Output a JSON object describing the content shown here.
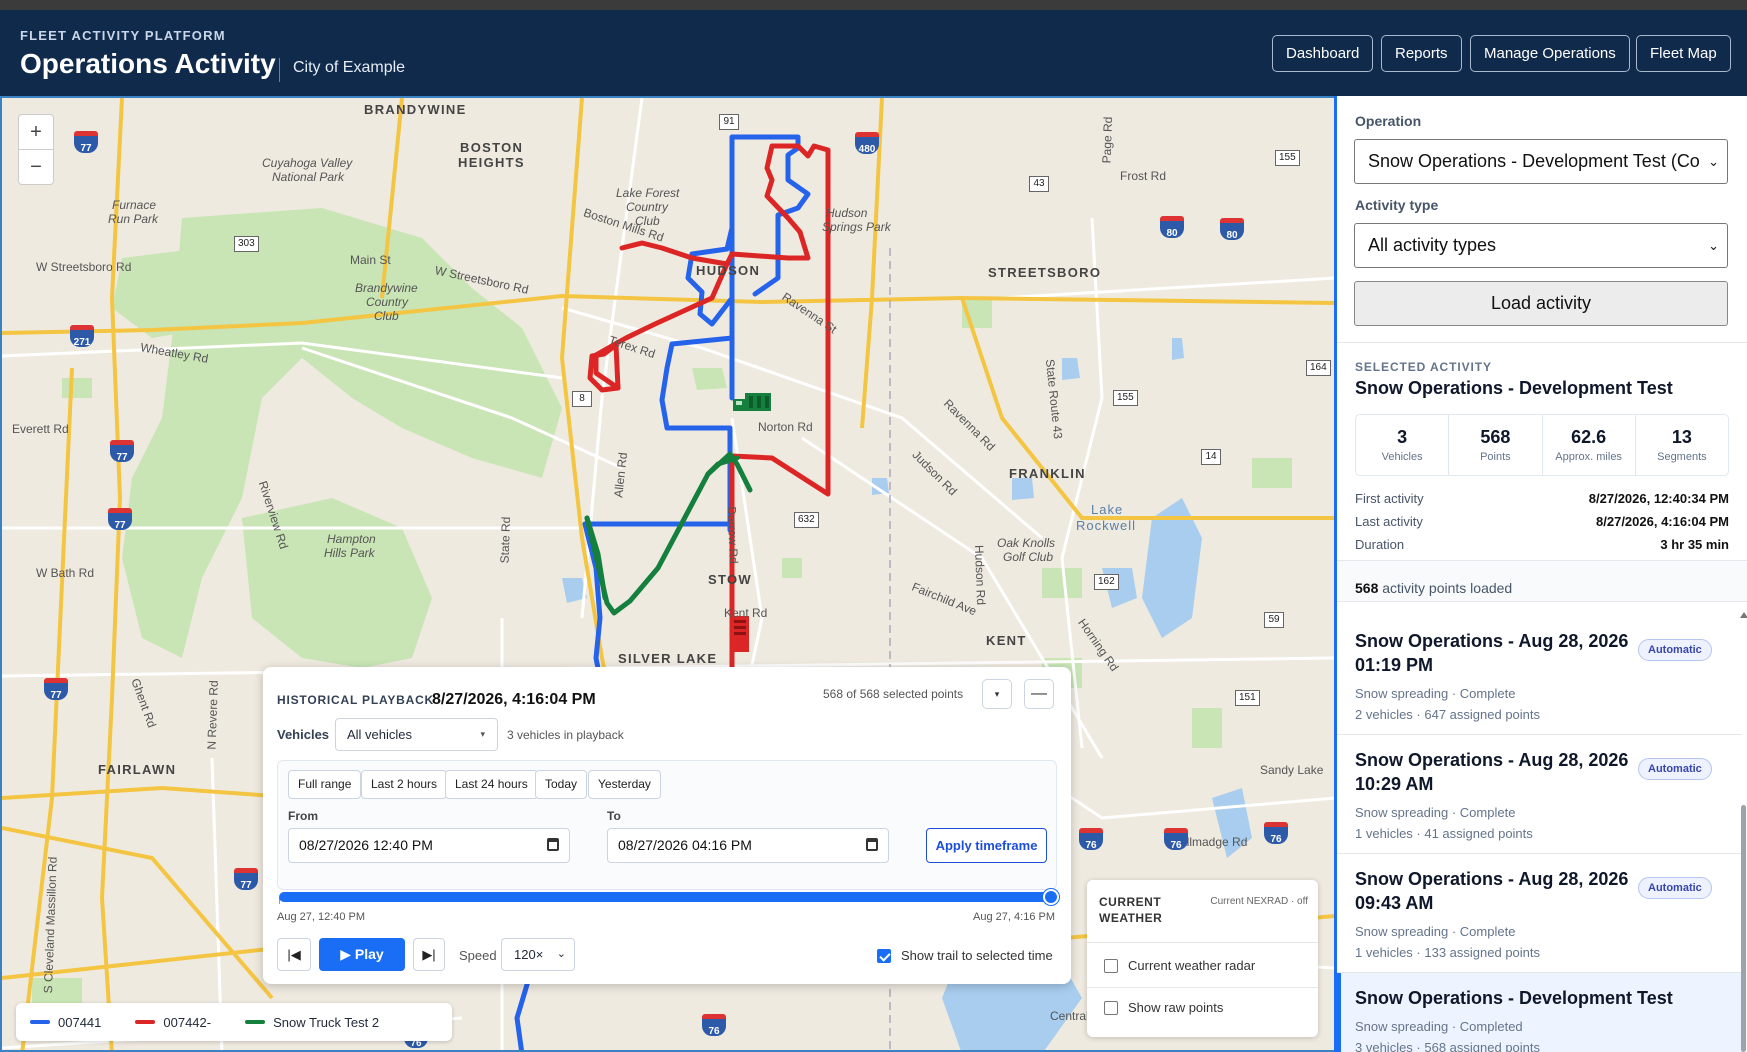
{
  "header": {
    "super_title": "FLEET ACTIVITY PLATFORM",
    "title": "Operations Activity",
    "org": "City of Example",
    "nav": [
      "Dashboard",
      "Reports",
      "Manage Operations",
      "Fleet Map"
    ]
  },
  "map": {
    "zoom_in": "+",
    "zoom_out": "−",
    "towns": [
      "BRANDYWINE",
      "BOSTON",
      "HEIGHTS",
      "HUDSON",
      "STREETSBORO",
      "FRANKLIN",
      "STOW",
      "SILVER LAKE",
      "KENT",
      "FAIRLAWN"
    ],
    "places": [
      "Cuyahoga Valley",
      "National Park",
      "Furnace",
      "Run Park",
      "Lake Forest",
      "Country",
      "Club",
      "Brandywine",
      "Country",
      "Club",
      "Hudson",
      "Springs Park",
      "Lake",
      "Rockwell",
      "Oak Knolls",
      "Golf Club",
      "Hampton",
      "Hills Park",
      "Sandy Lake"
    ],
    "roads": [
      "W Streetsboro Rd",
      "Main St",
      "W Streetsboro Rd",
      "Boston Mills Rd",
      "Frost Rd",
      "Ravenna St",
      "Terex Rd",
      "Wheatley Rd",
      "Everett Rd",
      "Norton Rd",
      "Ravenna Rd",
      "Judson Rd",
      "Allen Rd",
      "State Rd",
      "Darrow Rd",
      "Hudson Rd",
      "W Bath Rd",
      "Fairchild Ave",
      "Kent Rd",
      "Horning Rd",
      "Ghent Rd",
      "N Revere Rd",
      "Tallmadge Rd",
      "S Cleveland Massillon Rd",
      "Riverview Rd",
      "Page Rd",
      "State Route 43",
      "Central Scho"
    ],
    "routes": [
      "91",
      "480",
      "43",
      "155",
      "80",
      "80",
      "303",
      "77",
      "271",
      "8",
      "164",
      "155",
      "14",
      "77",
      "632",
      "77",
      "162",
      "59",
      "151",
      "77",
      "76",
      "76",
      "76",
      "77",
      "76",
      "76"
    ]
  },
  "legend": [
    {
      "label": "007441",
      "color": "#2563eb"
    },
    {
      "label": "007442-",
      "color": "#dc2626"
    },
    {
      "label": "Snow Truck Test 2",
      "color": "#15803d"
    }
  ],
  "playback": {
    "heading": "HISTORICAL PLAYBACK",
    "current_time": "8/27/2026, 4:16:04 PM",
    "selected_points": "568 of 568 selected points",
    "vehicles_label": "Vehicles",
    "vehicles_value": "All vehicles",
    "vehicles_count": "3 vehicles in playback",
    "ranges": [
      "Full range",
      "Last 2 hours",
      "Last 24 hours",
      "Today",
      "Yesterday"
    ],
    "from_label": "From",
    "from_value": "08/27/2026 12:40 PM",
    "to_label": "To",
    "to_value": "08/27/2026 04:16 PM",
    "apply_label": "Apply timeframe",
    "slider_start": "Aug 27, 12:40 PM",
    "slider_end": "Aug 27, 4:16 PM",
    "slider_position": 1.0,
    "play_label": "▶ Play",
    "speed_label": "Speed",
    "speed_value": "120×",
    "trail_label": "Show trail to selected time",
    "trail_checked": true
  },
  "weather": {
    "title": "CURRENT WEATHER",
    "note": "Current NEXRAD · off",
    "radar_label": "Current weather radar",
    "raw_label": "Show raw points"
  },
  "sidebar": {
    "operation_label": "Operation",
    "operation_value": "Snow Operations - Development Test (Co",
    "activity_label": "Activity type",
    "activity_value": "All activity types",
    "load_label": "Load activity",
    "selected_caption": "SELECTED ACTIVITY",
    "selected_name": "Snow Operations - Development Test",
    "stats": [
      {
        "value": "3",
        "label": "Vehicles"
      },
      {
        "value": "568",
        "label": "Points"
      },
      {
        "value": "62.6",
        "label": "Approx. miles"
      },
      {
        "value": "13",
        "label": "Segments"
      }
    ],
    "first_label": "First activity",
    "first_value": "8/27/2026, 12:40:34 PM",
    "last_label": "Last activity",
    "last_value": "8/27/2026, 4:16:04 PM",
    "duration_label": "Duration",
    "duration_value": "3 hr 35 min",
    "loaded_count": "568",
    "loaded_text": "activity points loaded",
    "items": [
      {
        "title": "Snow Operations - Aug 28, 2026 01:19 PM",
        "badge": "Automatic",
        "status": "Snow spreading · Complete",
        "meta": "2 vehicles · 647 assigned points"
      },
      {
        "title": "Snow Operations - Aug 28, 2026 10:29 AM",
        "badge": "Automatic",
        "status": "Snow spreading · Complete",
        "meta": "1 vehicles · 41 assigned points"
      },
      {
        "title": "Snow Operations - Aug 28, 2026 09:43 AM",
        "badge": "Automatic",
        "status": "Snow spreading · Complete",
        "meta": "1 vehicles · 133 assigned points"
      },
      {
        "title": "Snow Operations - Development Test",
        "badge": "",
        "status": "Snow spreading · Completed",
        "meta": "3 vehicles · 568 assigned points"
      }
    ]
  }
}
